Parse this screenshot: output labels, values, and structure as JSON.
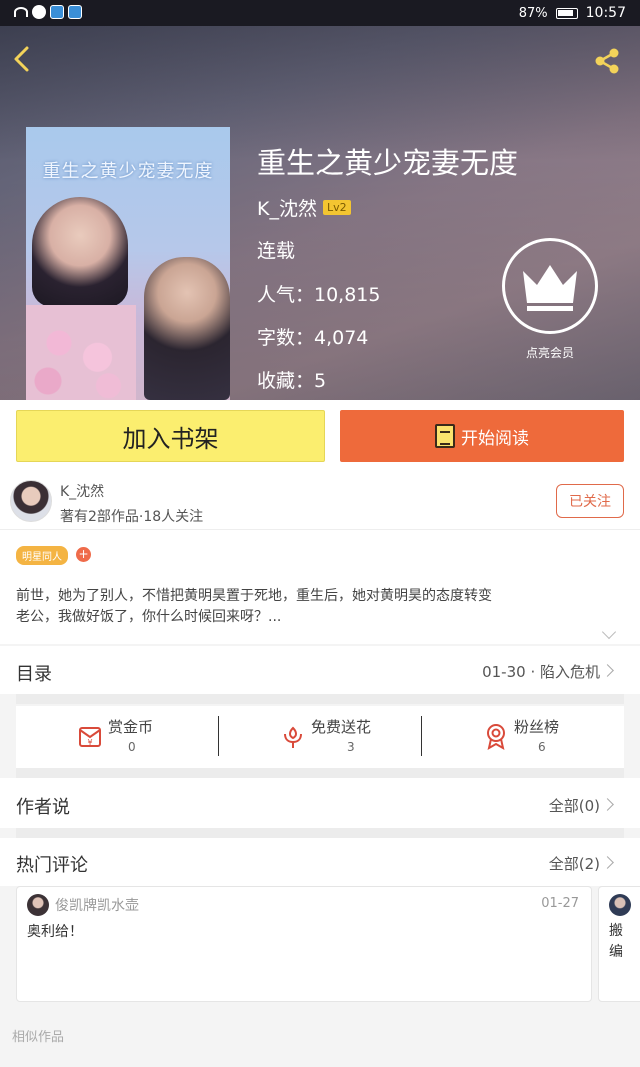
{
  "status_bar": {
    "battery": "87%",
    "time": "10:57"
  },
  "book": {
    "title": "重生之黄少宠妻无度",
    "cover_title": "重生之黄少宠妻无度",
    "author": "K_沈然",
    "level": "Lv2",
    "status": "连载",
    "popularity_label": "人气：10,815",
    "word_count_label": "字数：4,074",
    "favorites_label": "收藏：5"
  },
  "vip": {
    "label": "点亮会员"
  },
  "actions": {
    "add_shelf": "加入书架",
    "start_reading": "开始阅读"
  },
  "author_section": {
    "name": "K_沈然",
    "works": "著有2部作品·18人关注",
    "follow_label": "已关注"
  },
  "intro": {
    "tag": "明星同人",
    "tag_add": "+",
    "line1": "前世，她为了别人，不惜把黄明昊置于死地，重生后，她对黄明昊的态度转变",
    "line2": "老公，我做好饭了，你什么时候回来呀？..."
  },
  "catalog": {
    "title": "目录",
    "latest": "01-30 · 陷入危机"
  },
  "stats": [
    {
      "label": "赏金币",
      "value": "0",
      "icon": "coin-envelope-icon"
    },
    {
      "label": "免费送花",
      "value": "3",
      "icon": "flower-icon"
    },
    {
      "label": "粉丝榜",
      "value": "6",
      "icon": "medal-icon"
    }
  ],
  "author_says": {
    "title": "作者说",
    "count": "全部(0)"
  },
  "hot_comments": {
    "title": "热门评论",
    "count": "全部(2)",
    "items": [
      {
        "user": "俊凯牌凯水壶",
        "date": "01-27",
        "text": "奥利给！"
      },
      {
        "text_line1": "搬",
        "text_line2": "编"
      }
    ]
  },
  "similar": {
    "title": "相似作品"
  },
  "colors": {
    "accent_orange": "#ee6a3b",
    "shelf_yellow": "#fbee6f",
    "follow_red": "#e06a4a",
    "tag_orange": "#f4b443"
  }
}
